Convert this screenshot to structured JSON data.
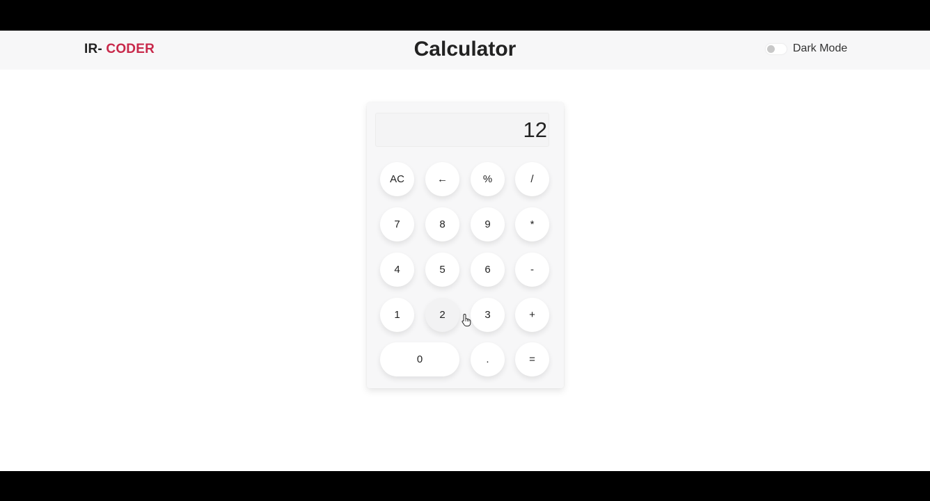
{
  "navbar": {
    "brand_prefix": "IR- ",
    "brand_accent": "CODER",
    "title": "Calculator",
    "dark_mode_label": "Dark Mode",
    "dark_mode_enabled": false
  },
  "calculator": {
    "display_value": "12",
    "keys": [
      [
        "AC",
        "←",
        "%",
        "/"
      ],
      [
        "7",
        "8",
        "9",
        "*"
      ],
      [
        "4",
        "5",
        "6",
        "-"
      ],
      [
        "1",
        "2",
        "3",
        "+"
      ],
      [
        "0",
        ".",
        "="
      ]
    ]
  },
  "colors": {
    "accent": "#c8284a",
    "navbar_bg": "#f7f7f8",
    "panel_bg": "#f7f7f8",
    "key_bg": "#ffffff"
  }
}
